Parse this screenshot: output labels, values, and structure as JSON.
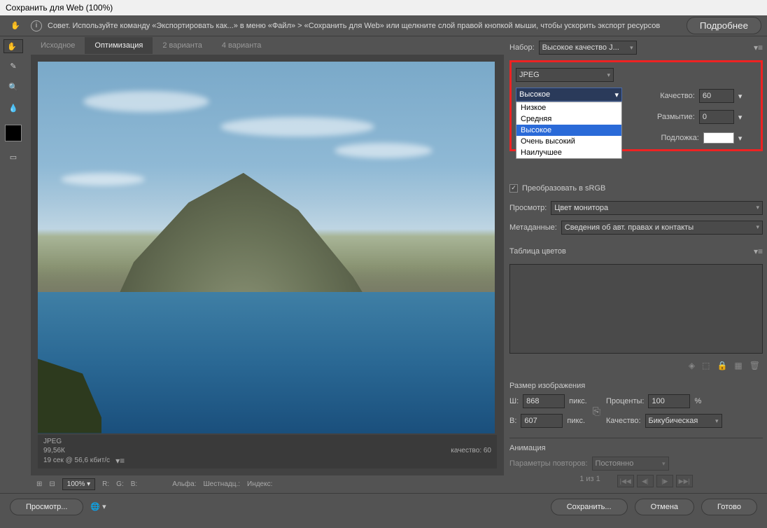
{
  "title": "Сохранить для Web (100%)",
  "tip": "Совет. Используйте команду «Экспортировать как...» в меню «Файл» > «Сохранить для Web» или щелкните слой правой кнопкой мыши, чтобы ускорить экспорт ресурсов",
  "more": "Подробнее",
  "tabs": {
    "t1": "Исходное",
    "t2": "Оптимизация",
    "t3": "2 варианта",
    "t4": "4 варианта"
  },
  "preview_meta": {
    "fmt": "JPEG",
    "size": "99,56К",
    "time": "19 сек @ 56,6 кбит/c",
    "quality": "качество: 60"
  },
  "zoom": "100%",
  "readout": {
    "r": "R:",
    "g": "G:",
    "b": "B:",
    "alpha": "Альфа:",
    "hex": "Шестнадц.:",
    "index": "Индекс:"
  },
  "preset": {
    "label": "Набор:",
    "value": "Высокое качество J..."
  },
  "format": "JPEG",
  "quality_preset": {
    "value": "Высокое",
    "options": [
      "Низкое",
      "Средняя",
      "Высокое",
      "Очень высокий",
      "Наилучшее"
    ]
  },
  "qual": {
    "label": "Качество:",
    "value": "60"
  },
  "blur": {
    "label": "Размытие:",
    "value": "0"
  },
  "matte": {
    "label": "Подложка:"
  },
  "srgb": "Преобразовать в sRGB",
  "preview_mode": {
    "label": "Просмотр:",
    "value": "Цвет монитора"
  },
  "metadata": {
    "label": "Метаданные:",
    "value": "Сведения об авт. правах и контакты"
  },
  "color_table": "Таблица цветов",
  "imgsize": {
    "title": "Размер изображения",
    "w_lbl": "Ш:",
    "w": "868",
    "h_lbl": "В:",
    "h": "607",
    "px": "пикс.",
    "pct_lbl": "Проценты:",
    "pct": "100",
    "pct_unit": "%",
    "q_lbl": "Качество:",
    "q": "Бикубическая"
  },
  "anim": {
    "title": "Анимация",
    "loop_lbl": "Параметры повторов:",
    "loop": "Постоянно",
    "counter": "1 из 1"
  },
  "footer": {
    "preview": "Просмотр...",
    "save": "Сохранить...",
    "cancel": "Отмена",
    "done": "Готово"
  }
}
